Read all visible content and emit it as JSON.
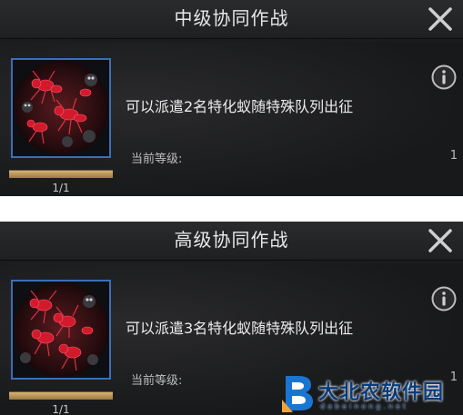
{
  "panels": [
    {
      "title": "中级协同作战",
      "description": "可以派遣2名特化蚁随特殊队列出征",
      "level_label": "当前等级:",
      "level_value": "1",
      "progress_text": "1/1",
      "progress_fraction": 1.0
    },
    {
      "title": "高级协同作战",
      "description": "可以派遣3名特化蚁随特殊队列出征",
      "level_label": "当前等级:",
      "level_value": "1",
      "progress_text": "1/1",
      "progress_fraction": 1.0
    }
  ],
  "icons": {
    "close": "close-icon",
    "info": "info-icon",
    "portrait": "ant-squad-portrait"
  },
  "colors": {
    "panel_bg": "#1b1c1e",
    "portrait_border": "#3c6fb6",
    "progress_fill": "#c9a66a",
    "ant_red": "#c8182a",
    "watermark": "#0a3b7a"
  },
  "watermark": {
    "text": "大北农软件园",
    "sub": "dabeinong.net"
  }
}
